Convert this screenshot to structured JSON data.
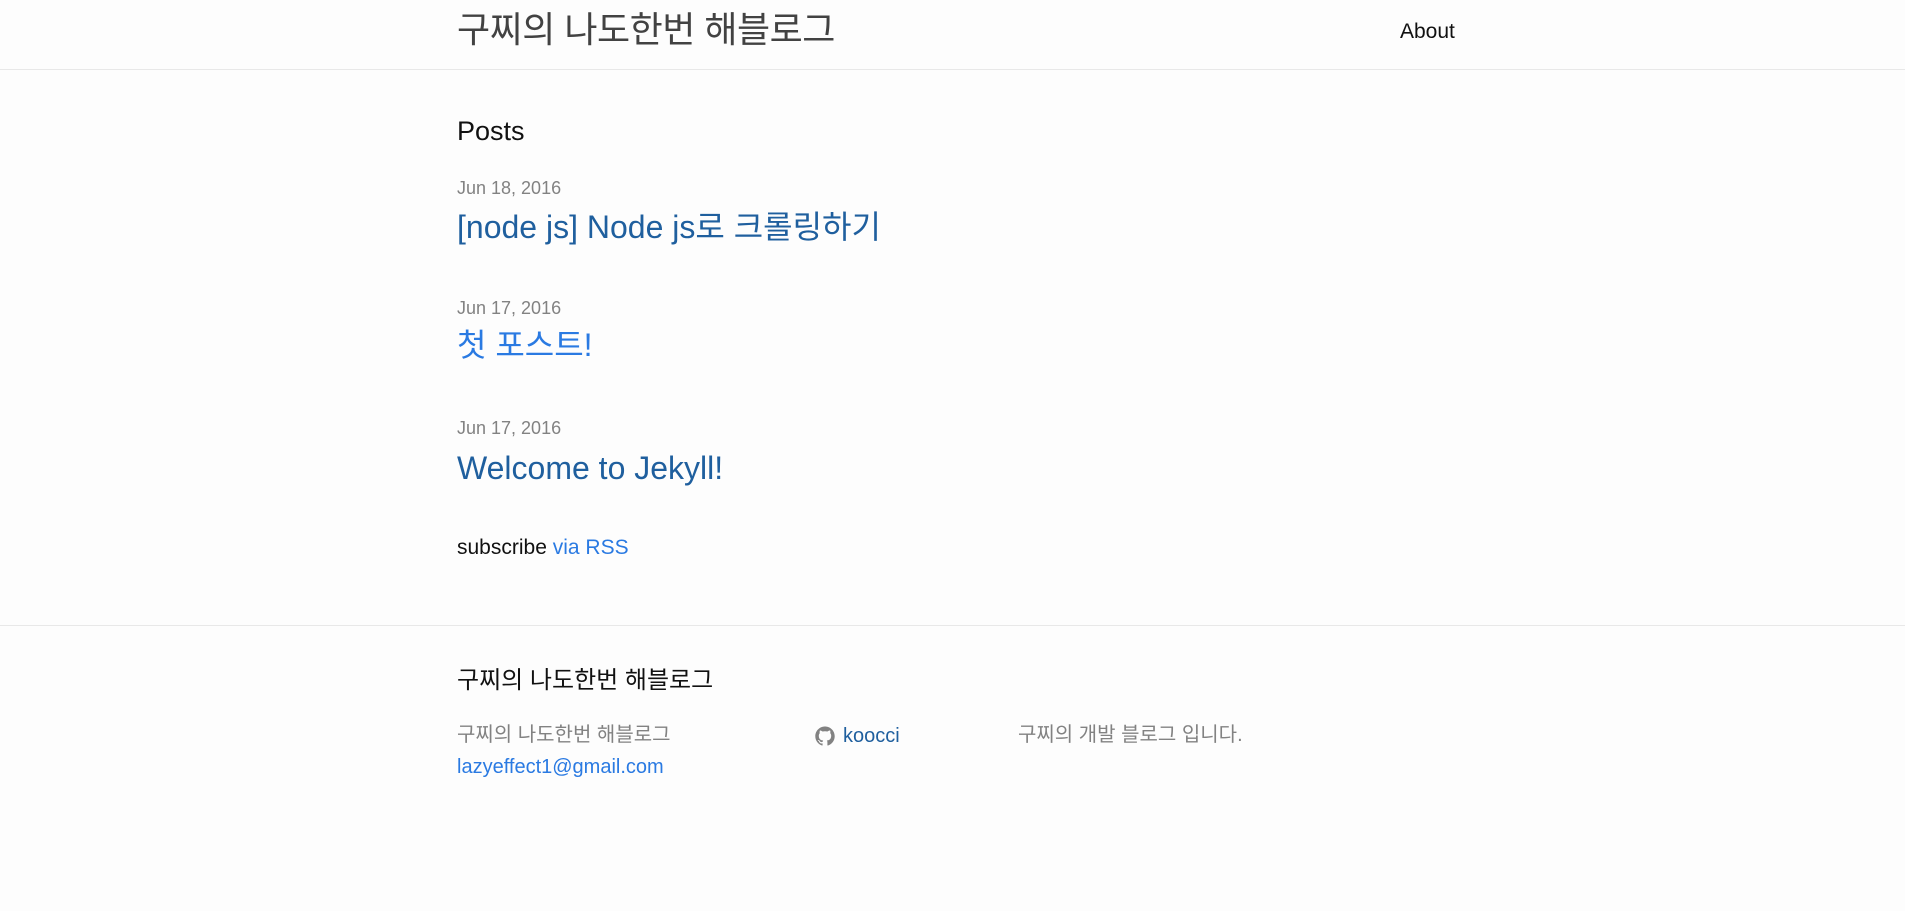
{
  "header": {
    "site_title": "구찌의 나도한번 해블로그",
    "nav": {
      "about": "About"
    }
  },
  "main": {
    "heading": "Posts",
    "posts": [
      {
        "date": "Jun 18, 2016",
        "title": "[node js] Node js로 크롤링하기"
      },
      {
        "date": "Jun 17, 2016",
        "title": "첫 포스트!"
      },
      {
        "date": "Jun 17, 2016",
        "title": "Welcome to Jekyll!"
      }
    ],
    "rss": {
      "prefix": "subscribe",
      "link": "via RSS"
    }
  },
  "footer": {
    "heading": "구찌의 나도한번 해블로그",
    "name": "구찌의 나도한번 해블로그",
    "email": "lazyeffect1@gmail.com",
    "github_username": "koocci",
    "description": "구찌의 개발 블로그 입니다."
  },
  "colors": {
    "link": "#2a7ae2",
    "link_visited": "#1f5f9e",
    "text": "#111111",
    "muted": "#828282",
    "border": "#e8e8e8",
    "background": "#fdfdfd"
  },
  "icons": {
    "github": "github-icon"
  }
}
